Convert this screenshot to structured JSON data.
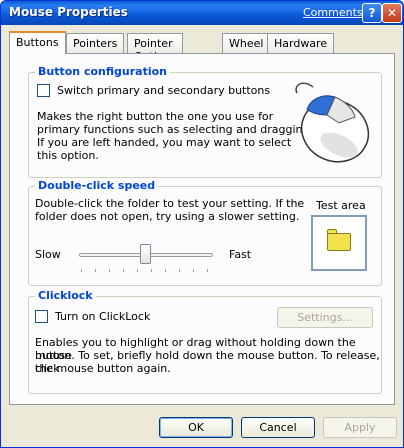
{
  "window": {
    "title": "Mouse Properties",
    "comments_link": "Comments?",
    "help_glyph": "?",
    "close_glyph": "✕"
  },
  "tabs": [
    {
      "label": "Buttons",
      "active": true
    },
    {
      "label": "Pointers",
      "active": false
    },
    {
      "label": "Pointer Options",
      "active": false
    },
    {
      "label": "Wheel",
      "active": false
    },
    {
      "label": "Hardware",
      "active": false
    }
  ],
  "button_config": {
    "title": "Button configuration",
    "checkbox_label": "Switch primary and secondary buttons",
    "checked": false,
    "description_lines": [
      "Makes the right button the one you use for",
      "primary functions such as selecting and dragging.",
      " If you are left handed, you may want to select",
      "this option."
    ]
  },
  "double_click": {
    "title": "Double-click speed",
    "description_lines": [
      "Double-click the folder to test your setting.  If the",
      "folder does not open, try using a slower setting."
    ],
    "slow_label": "Slow",
    "fast_label": "Fast",
    "slider_value": 0.5,
    "test_area_label": "Test area"
  },
  "clicklock": {
    "title": "Clicklock",
    "checkbox_label": "Turn on ClickLock",
    "checked": false,
    "settings_button": "Settings...",
    "description_lines": [
      "Enables you to highlight or drag without holding down the mouse",
      "button.  To set, briefly hold down the mouse button.  To release, click",
      "the mouse button again."
    ]
  },
  "footer": {
    "ok": "OK",
    "cancel": "Cancel",
    "apply": "Apply"
  },
  "colors": {
    "group_title": "#0046d5",
    "title_bar": "#0a58d6",
    "face": "#ece9d8"
  }
}
